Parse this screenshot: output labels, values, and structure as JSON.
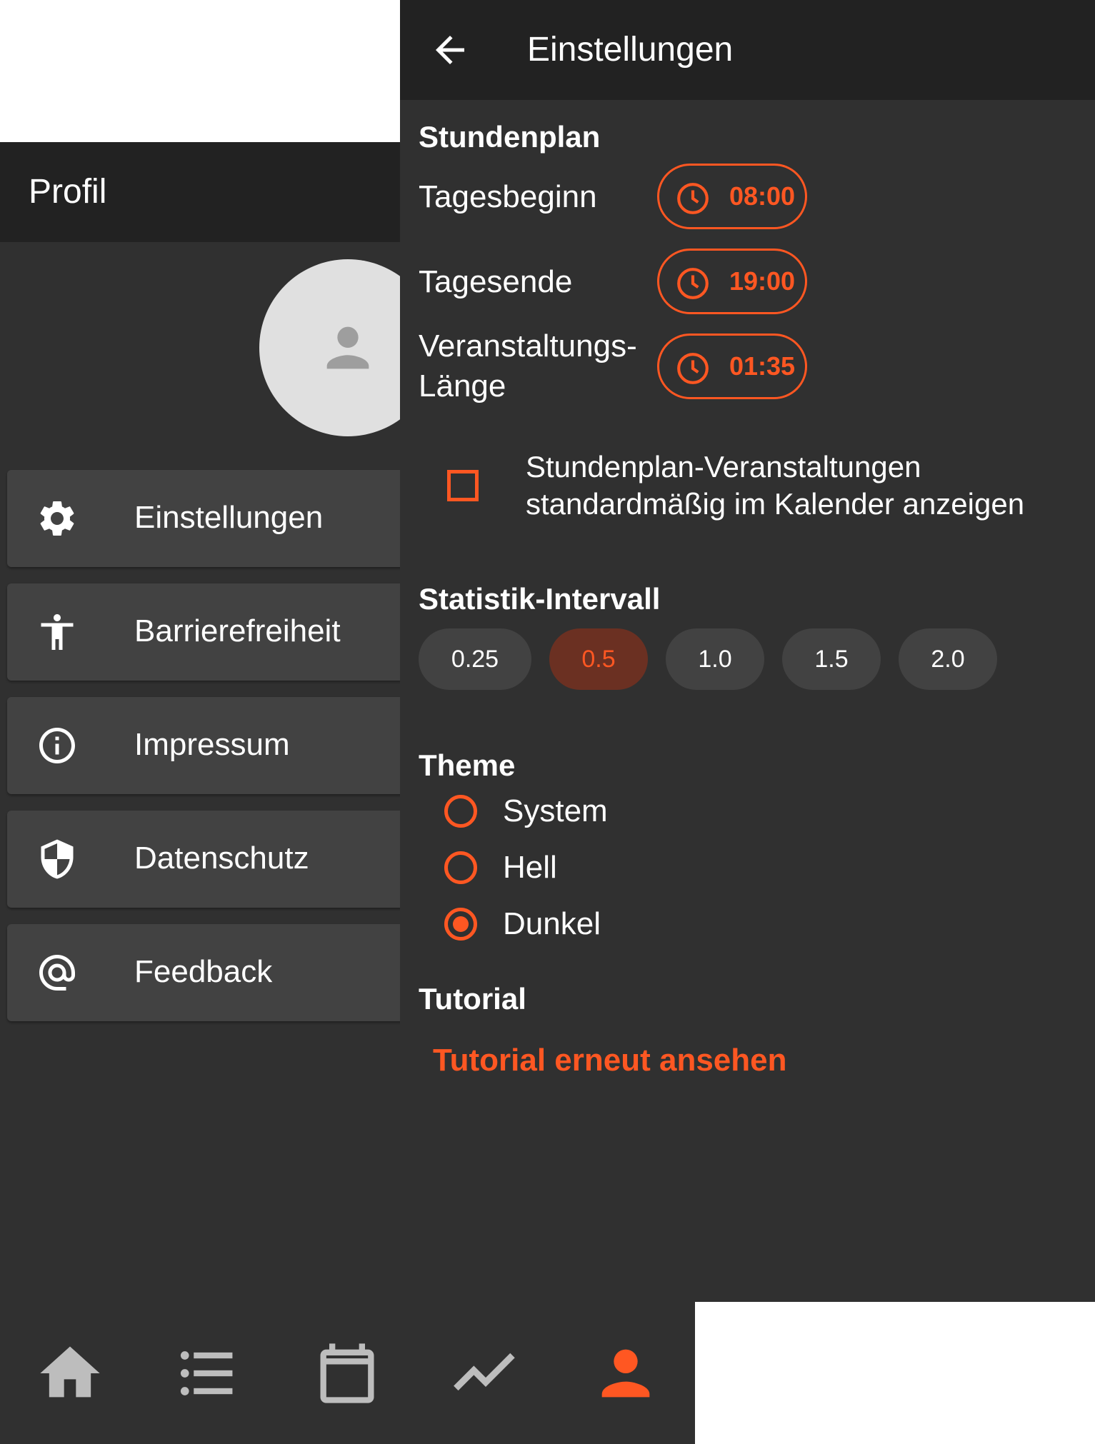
{
  "colors": {
    "accent": "#ff5722",
    "appbar": "#222222",
    "background": "#303030",
    "card": "#424242",
    "chip_selected_bg": "#6b3022"
  },
  "profile": {
    "title": "Profil",
    "avatar_icon": "person-icon",
    "menu": [
      {
        "label": "Einstellungen",
        "icon": "gear-icon"
      },
      {
        "label": "Barrierefreiheit",
        "icon": "accessibility-icon"
      },
      {
        "label": "Impressum",
        "icon": "info-icon"
      },
      {
        "label": "Datenschutz",
        "icon": "shield-icon"
      },
      {
        "label": "Feedback",
        "icon": "at-sign-icon"
      }
    ]
  },
  "bottom_nav": [
    {
      "icon": "home-icon",
      "active": false
    },
    {
      "icon": "list-icon",
      "active": false
    },
    {
      "icon": "calendar-icon",
      "active": false
    },
    {
      "icon": "trending-icon",
      "active": false
    },
    {
      "icon": "person-icon",
      "active": true
    }
  ],
  "settings": {
    "title": "Einstellungen",
    "back_icon": "arrow-back-icon",
    "timetable": {
      "title": "Stundenplan",
      "rows": [
        {
          "label": "Tagesbeginn",
          "value": "08:00",
          "icon": "clock-icon"
        },
        {
          "label": "Tagesende",
          "value": "19:00",
          "icon": "clock-icon"
        },
        {
          "label_line1": "Veranstaltungs-",
          "label_line2": "Länge",
          "value": "01:35",
          "icon": "clock-icon"
        }
      ],
      "checkbox": {
        "line1": "Stundenplan-Veranstaltungen",
        "line2": "standardmäßig im Kalender anzeigen",
        "checked": false
      }
    },
    "statistics": {
      "title": "Statistik-Intervall",
      "options": [
        "0.25",
        "0.5",
        "1.0",
        "1.5",
        "2.0"
      ],
      "selected": "0.5"
    },
    "theme": {
      "title": "Theme",
      "options": [
        "System",
        "Hell",
        "Dunkel"
      ],
      "selected": "Dunkel"
    },
    "tutorial": {
      "title": "Tutorial",
      "link": "Tutorial erneut ansehen"
    }
  }
}
